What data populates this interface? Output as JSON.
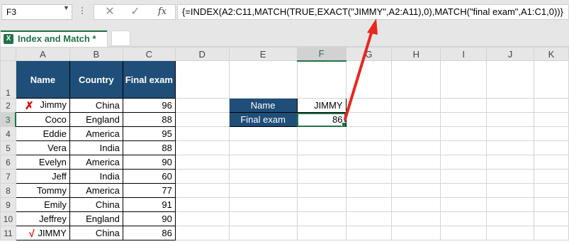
{
  "formula_bar": {
    "name_box": "F3",
    "cancel_label": "✕",
    "enter_label": "✓",
    "fx_label": "fx",
    "formula": "{=INDEX(A2:C11,MATCH(TRUE,EXACT(\"JIMMY\",A2:A11),0),MATCH(\"final exam\",A1:C1,0))}"
  },
  "workbook_tab": {
    "title": "Index and Match *",
    "icon_letter": "X"
  },
  "columns": [
    "A",
    "B",
    "C",
    "D",
    "E",
    "F",
    "G",
    "H",
    "I",
    "J",
    "K"
  ],
  "rows": [
    "1",
    "2",
    "3",
    "4",
    "5",
    "6",
    "7",
    "8",
    "9",
    "10",
    "11"
  ],
  "table": {
    "headers": [
      "Name",
      "Country",
      "Final exam"
    ],
    "data": [
      [
        "Jimmy",
        "China",
        "96"
      ],
      [
        "Coco",
        "England",
        "88"
      ],
      [
        "Eddie",
        "America",
        "95"
      ],
      [
        "Vera",
        "India",
        "88"
      ],
      [
        "Evelyn",
        "America",
        "90"
      ],
      [
        "Jeff",
        "India",
        "60"
      ],
      [
        "Tommy",
        "America",
        "77"
      ],
      [
        "Emily",
        "China",
        "91"
      ],
      [
        "Jeffrey",
        "England",
        "90"
      ],
      [
        "JIMMY",
        "China",
        "86"
      ]
    ]
  },
  "marks": {
    "wrong": "✗",
    "right": "√"
  },
  "lookup": {
    "name_label": "Name",
    "name_value": "JIMMY",
    "exam_label": "Final exam",
    "exam_value": "86"
  },
  "colors": {
    "header_fill": "#1f4e79",
    "excel_green": "#217346",
    "arrow": "#e8271e"
  },
  "active_cell": "F3"
}
